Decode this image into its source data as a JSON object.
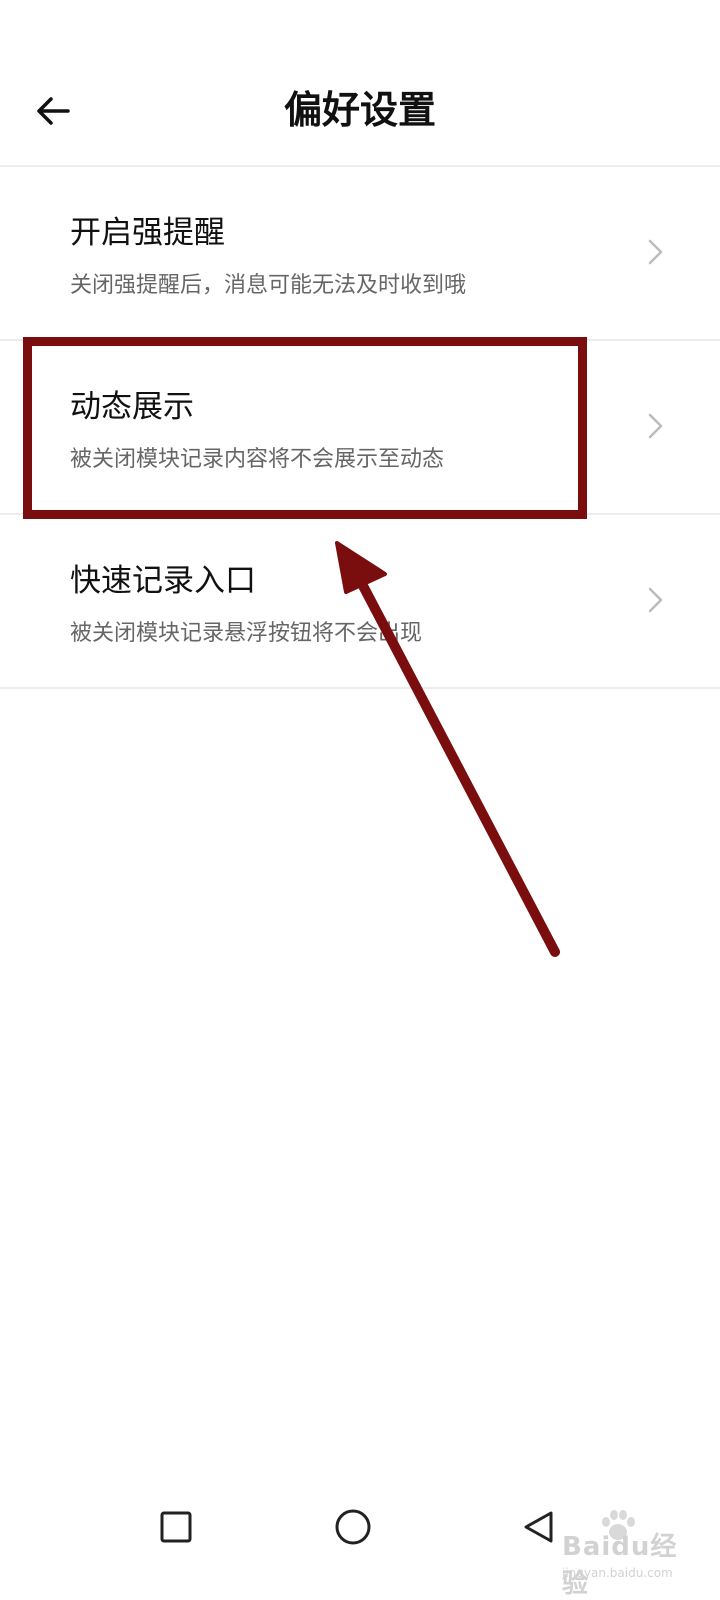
{
  "header": {
    "title": "偏好设置",
    "back_icon": "arrow-left-icon"
  },
  "items": [
    {
      "title": "开启强提醒",
      "description": "关闭强提醒后，消息可能无法及时收到哦",
      "chevron_icon": "chevron-right-icon"
    },
    {
      "title": "动态展示",
      "description": "被关闭模块记录内容将不会展示至动态",
      "chevron_icon": "chevron-right-icon"
    },
    {
      "title": "快速记录入口",
      "description": "被关闭模块记录悬浮按钮将不会出现",
      "chevron_icon": "chevron-right-icon"
    }
  ],
  "annotation": {
    "color": "#7a0e0e"
  },
  "navigation_bar": {
    "recent_icon": "square-icon",
    "home_icon": "circle-icon",
    "back_icon": "triangle-back-icon"
  },
  "watermark": {
    "brand": "Baidu经验",
    "url": "jingyan.baidu.com"
  }
}
